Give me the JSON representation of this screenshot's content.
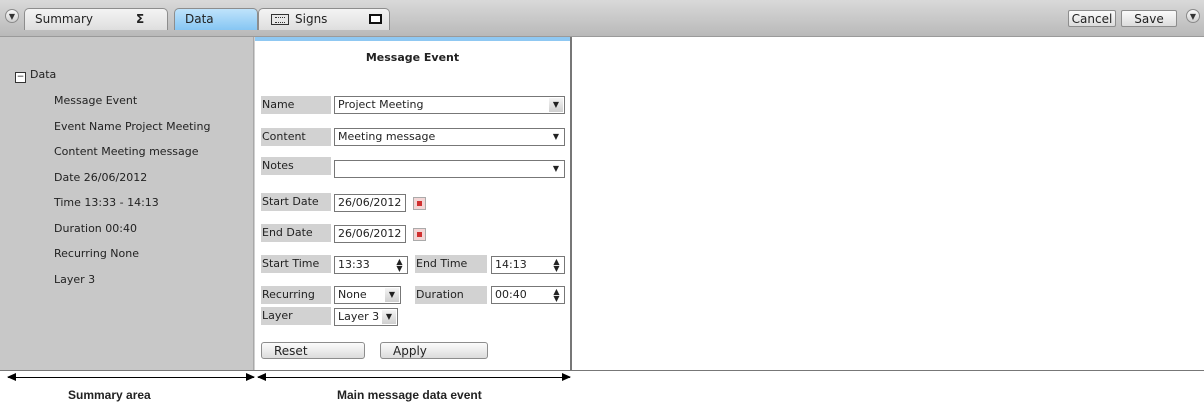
{
  "topbar": {
    "tabs": {
      "summary": "Summary",
      "summary_symbol": "Σ",
      "data": "Data",
      "signs": "Signs"
    },
    "cancel_label": "Cancel",
    "save_label": "Save",
    "icons": [
      "chevron-down-icon",
      "sigma-icon",
      "keyboard-icon",
      "square-icon"
    ]
  },
  "summary": {
    "root_toggle": "−",
    "root_label": "Data",
    "items": [
      "Message Event",
      "Event Name Project Meeting",
      "Content Meeting message",
      "Date 26/06/2012",
      "Time 13:33 - 14:13",
      "Duration 00:40",
      "Recurring None",
      "Layer 3"
    ]
  },
  "main": {
    "title": "Message Event",
    "form": {
      "name": {
        "label": "Name",
        "value": "Project Meeting"
      },
      "content": {
        "label": "Content",
        "value": "Meeting message"
      },
      "notes": {
        "label": "Notes",
        "value": ""
      },
      "start_date": {
        "label": "Start Date",
        "value": "26/06/2012"
      },
      "end_date": {
        "label": "End Date",
        "value": "26/06/2012"
      },
      "start_time": {
        "label": "Start Time",
        "value": "13:33"
      },
      "end_time": {
        "label": "End Time",
        "value": "14:13"
      },
      "recurring": {
        "label": "Recurring",
        "value": "None"
      },
      "duration": {
        "label": "Duration",
        "value": "00:40"
      },
      "layer": {
        "label": "Layer",
        "value": "Layer 3"
      }
    },
    "reset_label": "Reset",
    "apply_label": "Apply"
  },
  "annotations": {
    "summary_area": "Summary area",
    "main_area": "Main message data event"
  },
  "colors": {
    "active_tab": "#86c6f3",
    "panel_bg": "#c8c8c8",
    "accent_line": "#8fc8f2"
  }
}
